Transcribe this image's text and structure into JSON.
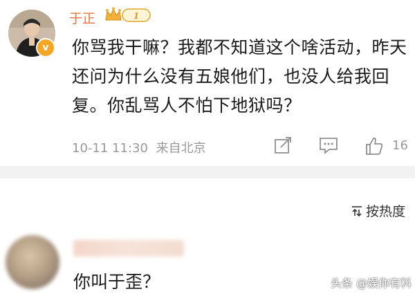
{
  "post": {
    "username": "于正",
    "vip_level": "1",
    "verified_icon": "v",
    "text": "你骂我干嘛？我都不知道这个啥活动，昨天还问为什么没有五娘他们，也没人给我回复。你乱骂人不怕下地狱吗？",
    "timestamp": "10-11 11:30",
    "source": "来自北京",
    "like_count": "16",
    "colors": {
      "username": "#eb7340",
      "meta": "#999999",
      "verified": "#f5a623"
    }
  },
  "comments": {
    "sort_label": "按热度",
    "items": [
      {
        "text": "你叫于歪？"
      }
    ]
  },
  "watermark": "头条 @娱你有料"
}
